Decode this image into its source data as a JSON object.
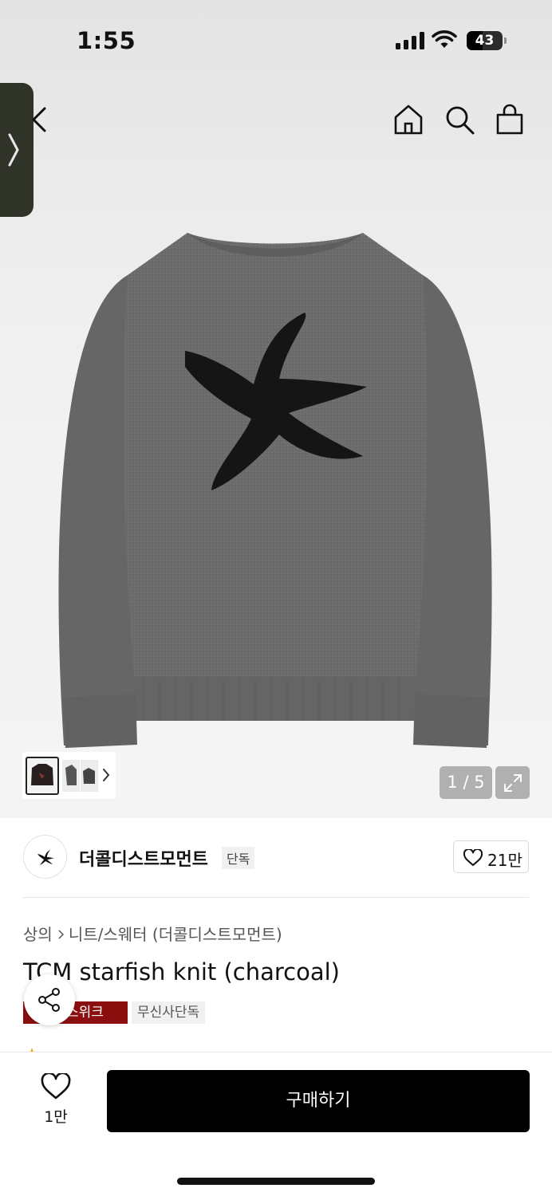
{
  "status_bar": {
    "time": "1:55",
    "battery": "43"
  },
  "nav": {
    "back": "back-icon",
    "home": "home-icon",
    "search": "search-icon",
    "bag": "shopping-bag-icon"
  },
  "gallery": {
    "page_indicator": "1 / 5",
    "current_page": 1,
    "total_pages": 5
  },
  "brand": {
    "name": "더콜디스트모먼트",
    "exclusive_badge": "단독",
    "like_count": "21만"
  },
  "breadcrumb": {
    "category": "상의",
    "subcategory": "니트/스웨터 (더콜디스트모먼트)"
  },
  "product": {
    "title": "TCM starfish knit (charcoal)",
    "event_tag": "무진장 스위크",
    "event_tag_visible": "스위크",
    "exclusive_tag": "무신사단독"
  },
  "bottom_bar": {
    "wish_count": "1만",
    "buy_label": "구매하기"
  },
  "colors": {
    "primary": "#000000",
    "event_tag": "#8c0f0f",
    "sweater": "#6b6b6b",
    "starfish": "#151515"
  }
}
